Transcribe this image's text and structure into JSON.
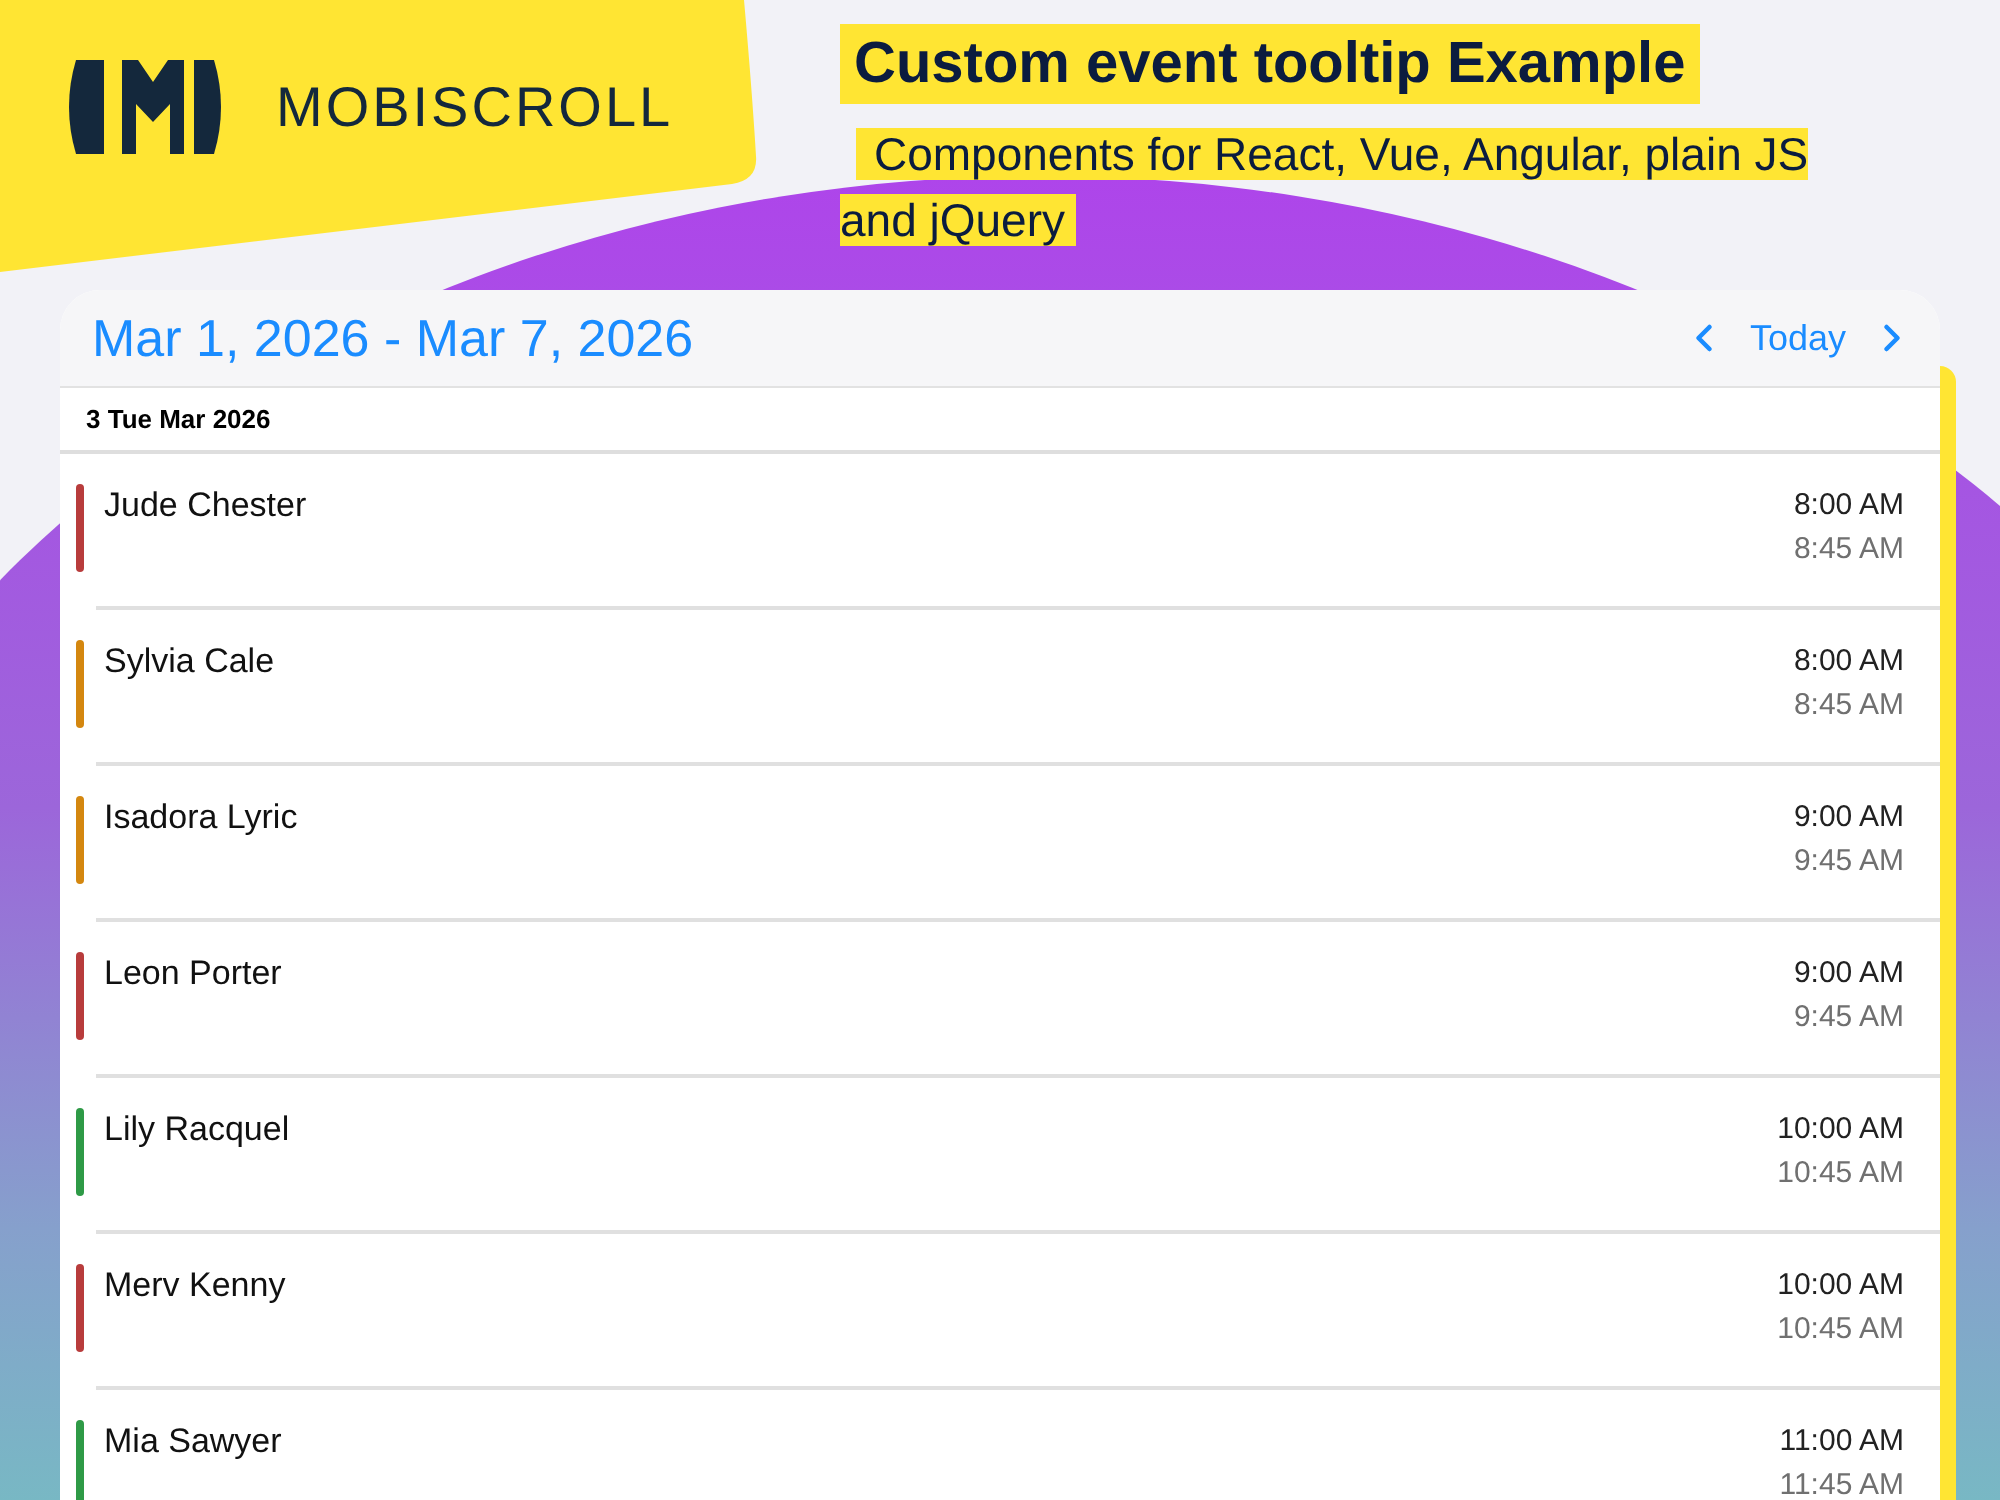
{
  "logo": {
    "wordmark": "MOBISCROLL"
  },
  "heading": {
    "title": "Custom event tooltip Example",
    "subtitle": "Components for React, Vue, Angular, plain JS and jQuery"
  },
  "calendar": {
    "range": "Mar 1, 2026 - Mar 7, 2026",
    "today": "Today",
    "day": "3 Tue Mar 2026",
    "events": [
      {
        "title": "Jude Chester",
        "start": "8:00 AM",
        "end": "8:45 AM",
        "color": "#b83c3c"
      },
      {
        "title": "Sylvia Cale",
        "start": "8:00 AM",
        "end": "8:45 AM",
        "color": "#d4870f"
      },
      {
        "title": "Isadora Lyric",
        "start": "9:00 AM",
        "end": "9:45 AM",
        "color": "#d4870f"
      },
      {
        "title": "Leon Porter",
        "start": "9:00 AM",
        "end": "9:45 AM",
        "color": "#b83c3c"
      },
      {
        "title": "Lily Racquel",
        "start": "10:00 AM",
        "end": "10:45 AM",
        "color": "#2e9a46"
      },
      {
        "title": "Merv Kenny",
        "start": "10:00 AM",
        "end": "10:45 AM",
        "color": "#b83c3c"
      },
      {
        "title": "Mia Sawyer",
        "start": "11:00 AM",
        "end": "11:45 AM",
        "color": "#2e9a46"
      }
    ]
  }
}
